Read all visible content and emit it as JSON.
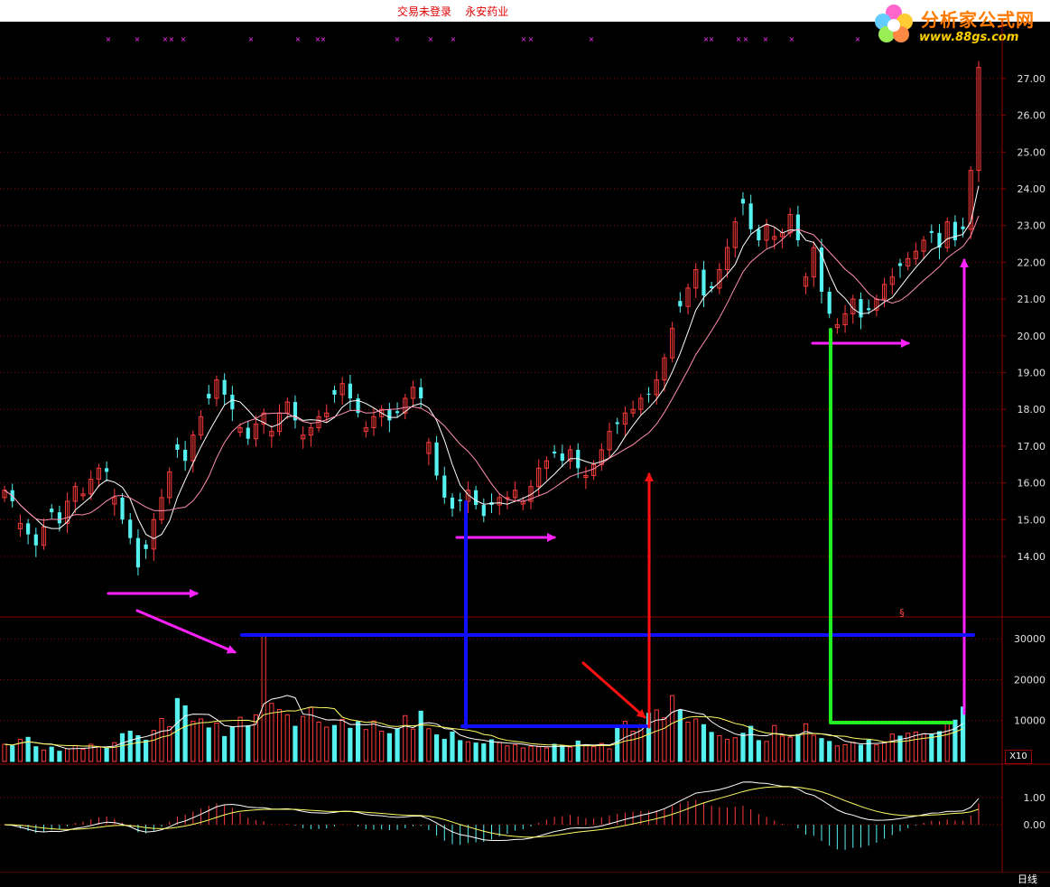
{
  "header": {
    "status_text": "交易未登录    永安药业",
    "logo_brand": "分析家公式网",
    "logo_url": "www.88gs.com"
  },
  "period_label": "日线",
  "volume_multiplier_label": "X10",
  "colors": {
    "up": "#ff3b3b",
    "down": "#55f0f0",
    "grid": "#8a0000",
    "ma_fast": "#ffffff",
    "ma_slow": "#ff8fb0",
    "vol_ma_a": "#ffffff",
    "vol_ma_b": "#ffff66",
    "macd_dif": "#ffffff",
    "macd_dea": "#ffff66",
    "annotation_magenta": "#ff22ff",
    "annotation_blue": "#1010ff",
    "annotation_red": "#ff1010",
    "annotation_green": "#22ee22"
  },
  "chart_data": [
    {
      "type": "candlestick",
      "panel": "price",
      "y_ticks": [
        "14.00",
        "15.00",
        "16.00",
        "17.00",
        "18.00",
        "19.00",
        "20.00",
        "21.00",
        "22.00",
        "23.00",
        "24.00",
        "25.00",
        "26.00",
        "27.00"
      ],
      "ylim": [
        13.0,
        28.0
      ],
      "x_ticks": [
        "2",
        "3",
        "4",
        "5",
        "6",
        "7",
        "8"
      ],
      "close": [
        15.8,
        15.5,
        14.9,
        14.6,
        14.3,
        14.8,
        15.2,
        14.9,
        15.5,
        15.9,
        15.7,
        16.1,
        16.4,
        16.3,
        15.6,
        15.0,
        14.5,
        13.7,
        14.2,
        15.0,
        15.6,
        16.3,
        16.9,
        16.6,
        17.3,
        17.8,
        18.3,
        18.8,
        18.4,
        18.0,
        17.5,
        17.2,
        17.6,
        17.9,
        17.4,
        17.9,
        18.2,
        17.7,
        17.3,
        17.5,
        17.8,
        17.9,
        18.4,
        18.7,
        18.3,
        17.9,
        17.5,
        17.8,
        18.0,
        17.7,
        17.9,
        18.3,
        18.6,
        18.3,
        17.1,
        16.2,
        15.6,
        15.3,
        15.5,
        15.8,
        15.4,
        15.1,
        15.4,
        15.6,
        15.6,
        15.8,
        15.5,
        15.9,
        16.4,
        16.6,
        16.8,
        16.6,
        16.9,
        16.4,
        16.2,
        16.5,
        16.9,
        17.4,
        17.6,
        17.9,
        18.0,
        18.3,
        18.4,
        18.8,
        19.4,
        20.2,
        20.8,
        21.3,
        21.8,
        21.1,
        21.3,
        21.8,
        22.4,
        23.1,
        23.6,
        22.9,
        22.6,
        23.0,
        22.7,
        22.8,
        23.3,
        22.6,
        21.6,
        22.4,
        21.2,
        20.6,
        20.3,
        20.6,
        21.0,
        20.5,
        20.7,
        21.0,
        21.4,
        21.6,
        21.9,
        22.1,
        22.3,
        22.6,
        22.8,
        22.4,
        23.1,
        22.6,
        22.9,
        24.5,
        27.3
      ],
      "ma_fast": "5-day moving average (white)",
      "ma_slow": "10-day moving average (pink)"
    },
    {
      "type": "bar",
      "panel": "volume",
      "y_ticks": [
        "10000",
        "20000",
        "30000"
      ],
      "ylim": [
        0,
        35000
      ],
      "note_label": "§",
      "values": [
        4200,
        3800,
        5400,
        5900,
        3600,
        2800,
        3500,
        2500,
        3100,
        3900,
        3000,
        4200,
        3600,
        3300,
        4600,
        6800,
        7400,
        6300,
        5200,
        7600,
        10500,
        8500,
        15400,
        13600,
        9800,
        10400,
        8200,
        9400,
        6100,
        8400,
        10800,
        8700,
        11400,
        31000,
        14200,
        12700,
        11400,
        8600,
        11000,
        13200,
        9600,
        8400,
        8800,
        10300,
        8100,
        9700,
        7800,
        9900,
        7400,
        6800,
        8000,
        11200,
        7900,
        12300,
        8000,
        6500,
        5400,
        7200,
        5100,
        4800,
        4500,
        4300,
        5300,
        4600,
        3800,
        4100,
        3300,
        3700,
        3600,
        3300,
        4200,
        3800,
        3500,
        5000,
        4100,
        3600,
        4400,
        3100,
        8600,
        9800,
        7400,
        9000,
        11800,
        12600,
        10700,
        16100,
        12500,
        9600,
        10400,
        9000,
        7100,
        6300,
        5400,
        5800,
        6900,
        8600,
        5100,
        4900,
        8800,
        6200,
        5900,
        6600,
        9200,
        6400,
        5600,
        4900,
        3800,
        4100,
        4700,
        4000,
        5200,
        4100,
        4800,
        6700,
        6200,
        6900,
        7200,
        6800,
        6600,
        7300,
        9200,
        10100,
        13300
      ]
    },
    {
      "type": "bar",
      "panel": "macd",
      "y_ticks": [
        "0.00",
        "1.00"
      ],
      "ylim": [
        -0.9,
        1.6
      ]
    }
  ]
}
